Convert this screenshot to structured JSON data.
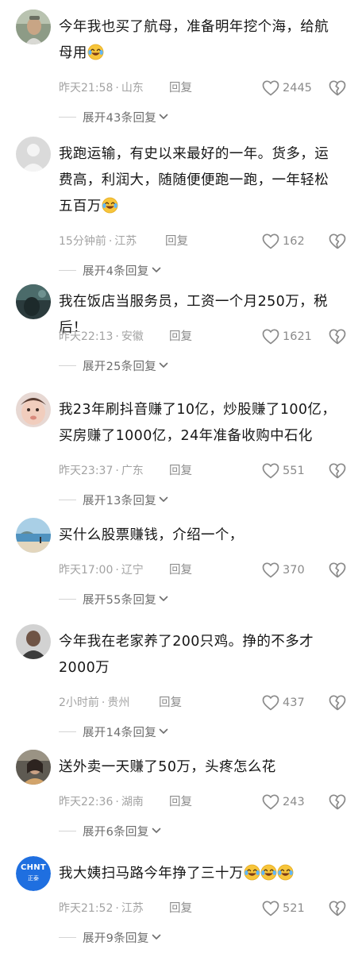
{
  "comments": [
    {
      "avatar": "avatar-portrait-old-man",
      "text_lines": [
        "今年我也买了航母，准备明年挖个海，给航",
        "母用"
      ],
      "emoji_count": 1,
      "time": "昨天21:58",
      "location": "山东",
      "reply_label": "回复",
      "likes": "2445",
      "expand_label": "展开43条回复"
    },
    {
      "avatar": "avatar-default-gray",
      "text_lines": [
        "我跑运输，有史以来最好的一年。货多，运",
        "费高，利润大，随随便便跑一跑，一年轻松",
        "五百万"
      ],
      "emoji_count": 1,
      "time": "15分钟前",
      "location": "江苏",
      "reply_label": "回复",
      "likes": "162",
      "expand_label": "展开4条回复"
    },
    {
      "avatar": "avatar-dark-teal",
      "text_lines": [
        "我在饭店当服务员，工资一个月250万，税后！"
      ],
      "emoji_count": 0,
      "time": "昨天22:13",
      "location": "安徽",
      "reply_label": "回复",
      "likes": "1621",
      "expand_label": "展开25条回复"
    },
    {
      "avatar": "avatar-baby",
      "text_lines": [
        "我23年刷抖音赚了10亿，炒股赚了100亿，",
        "买房赚了1000亿，24年准备收购中石化"
      ],
      "emoji_count": 0,
      "time": "昨天23:37",
      "location": "广东",
      "reply_label": "回复",
      "likes": "551",
      "expand_label": "展开13条回复"
    },
    {
      "avatar": "avatar-beach",
      "text_lines": [
        "买什么股票赚钱，介绍一个，"
      ],
      "emoji_count": 0,
      "time": "昨天17:00",
      "location": "辽宁",
      "reply_label": "回复",
      "likes": "370",
      "expand_label": "展开55条回复"
    },
    {
      "avatar": "avatar-man-dark",
      "text_lines": [
        "今年我在老家养了200只鸡。挣的不多才",
        "2000万"
      ],
      "emoji_count": 0,
      "time": "2小时前",
      "location": "贵州",
      "reply_label": "回复",
      "likes": "437",
      "expand_label": "展开14条回复"
    },
    {
      "avatar": "avatar-woman-car",
      "text_lines": [
        "送外卖一天赚了50万，头疼怎么花"
      ],
      "emoji_count": 0,
      "time": "昨天22:36",
      "location": "湖南",
      "reply_label": "回复",
      "likes": "243",
      "expand_label": "展开6条回复"
    },
    {
      "avatar": "avatar-chnt-logo",
      "logo_main": "CHNT",
      "logo_sub": "正泰",
      "text_lines": [
        "我大姨扫马路今年挣了三十万"
      ],
      "emoji_count": 3,
      "time": "昨天21:52",
      "location": "江苏",
      "reply_label": "回复",
      "likes": "521",
      "expand_label": "展开9条回复"
    }
  ],
  "colors": {
    "text": "#161616",
    "meta": "#a3a3a3",
    "icon": "#8a8a8a",
    "expand": "#6d6d6d",
    "logo_blue": "#1f6fe0"
  },
  "icons": {
    "like": "heart-outline-icon",
    "dislike": "broken-heart-icon",
    "expand": "chevron-down-icon",
    "emoji": "laughing-tears-emoji"
  }
}
